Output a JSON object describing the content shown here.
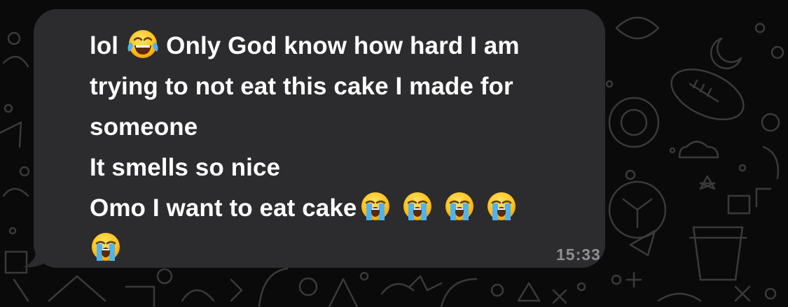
{
  "chat": {
    "background_color": "#0a0a0a",
    "doodle_color": "#3a3a3a",
    "bubble_color": "#2c2c2e"
  },
  "message": {
    "lines": [
      "lol",
      "Only God know how hard I am",
      "trying to not eat this cake I made for",
      "someone",
      "It smells so nice",
      "Omo I want to eat cake"
    ],
    "emojis": {
      "laughing": "face-with-tears-of-joy-icon",
      "crying": "loudly-crying-face-icon",
      "crying_count": 5
    },
    "timestamp": "15:33",
    "text_color": "#ffffff",
    "timestamp_color": "#8e8e93"
  }
}
